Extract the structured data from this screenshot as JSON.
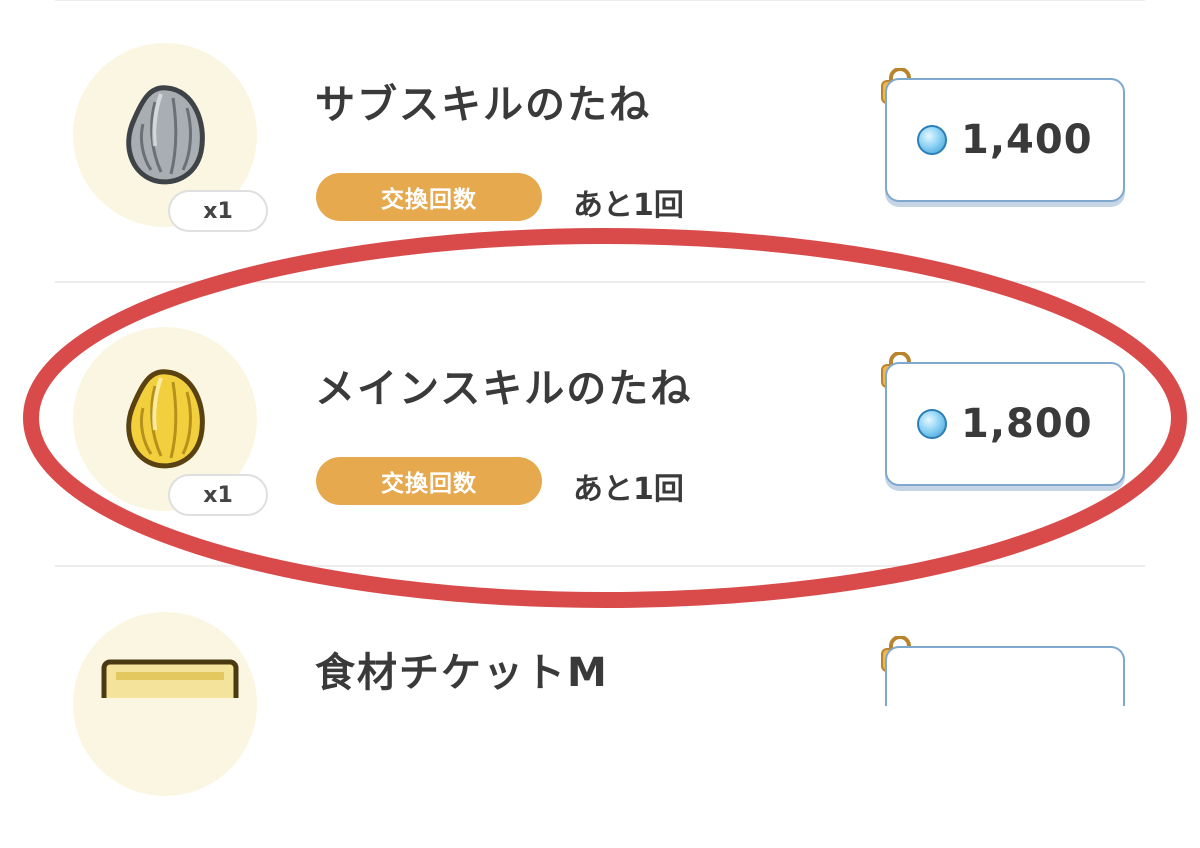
{
  "items": [
    {
      "title": "サブスキルのたね",
      "quantity": "x1",
      "exchange_label": "交換回数",
      "remaining": "あと1回",
      "price": "1,400",
      "seed_color": "#a9aeb3",
      "icon": "gray-seed-icon"
    },
    {
      "title": "メインスキルのたね",
      "quantity": "x1",
      "exchange_label": "交換回数",
      "remaining": "あと1回",
      "price": "1,800",
      "seed_color": "#f2cf3c",
      "icon": "gold-seed-icon"
    },
    {
      "title": "食材チケットM",
      "icon": "ticket-icon"
    }
  ],
  "colors": {
    "badge": "#e7a94e",
    "button_border": "#7fa8cf",
    "highlight_ring": "#d94a4a",
    "icon_background": "#fbf6e1"
  }
}
